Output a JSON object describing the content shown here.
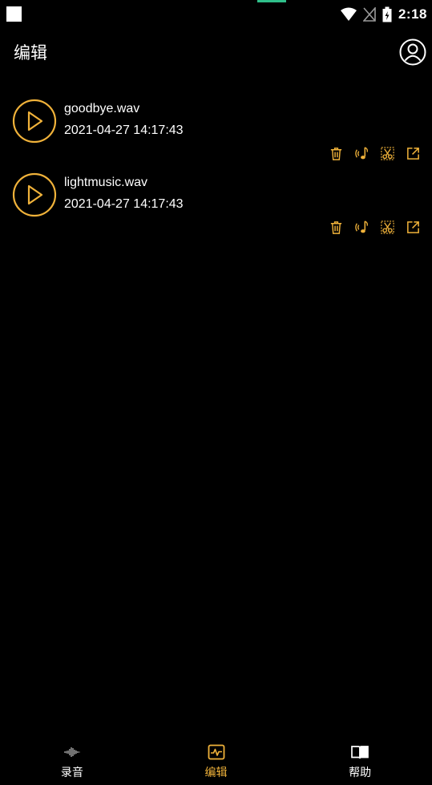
{
  "status_bar": {
    "time": "2:18"
  },
  "header": {
    "title": "编辑"
  },
  "files": [
    {
      "name": "goodbye.wav",
      "date": "2021-04-27 14:17:43"
    },
    {
      "name": "lightmusic.wav",
      "date": "2021-04-27 14:17:43"
    }
  ],
  "nav": {
    "items": [
      {
        "label": "录音",
        "icon": "waveform-icon",
        "active": false
      },
      {
        "label": "编辑",
        "icon": "edit-pulse-icon",
        "active": true
      },
      {
        "label": "帮助",
        "icon": "book-icon",
        "active": false
      }
    ]
  },
  "colors": {
    "accent": "#f0b23a",
    "background": "#000000",
    "text": "#ffffff",
    "status_accent": "#2fbf8a"
  }
}
